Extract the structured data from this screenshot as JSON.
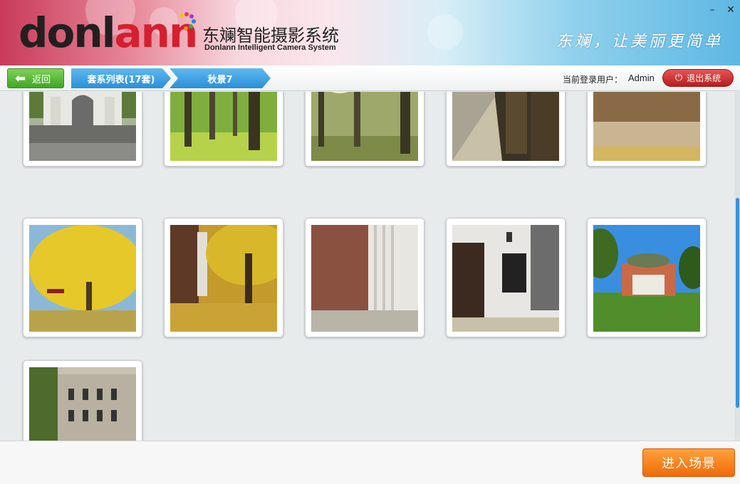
{
  "header": {
    "logo_prefix": "donl",
    "logo_suffix": "ann",
    "title_cn": "东斓智能摄影系统",
    "title_en": "Donlann Intelligent Camera System",
    "slogan": "东斓，让美丽更简单",
    "minimize_label": "–",
    "close_label": "✕"
  },
  "nav": {
    "back_label": "返回",
    "breadcrumbs": [
      "套系列表(17套)",
      "秋景7"
    ],
    "user_label": "当前登录用户：",
    "user_name": "Admin",
    "logout_label": "退出系统"
  },
  "gallery": {
    "photos": [
      {
        "subject": "school-gate"
      },
      {
        "subject": "green-trees"
      },
      {
        "subject": "sunlit-trees"
      },
      {
        "subject": "tree-lined-road"
      },
      {
        "subject": "brick-wall"
      },
      {
        "subject": "yellow-ginkgo"
      },
      {
        "subject": "ginkgo-building"
      },
      {
        "subject": "column-brick"
      },
      {
        "subject": "white-wall-window"
      },
      {
        "subject": "auditorium-lawn"
      },
      {
        "subject": "old-building"
      }
    ]
  },
  "footer": {
    "enter_label": "进入场景"
  },
  "colors": {
    "accent_blue": "#2a8fd8",
    "back_green": "#3fa625",
    "logout_red": "#b81e1e",
    "enter_orange": "#f06b0a"
  }
}
